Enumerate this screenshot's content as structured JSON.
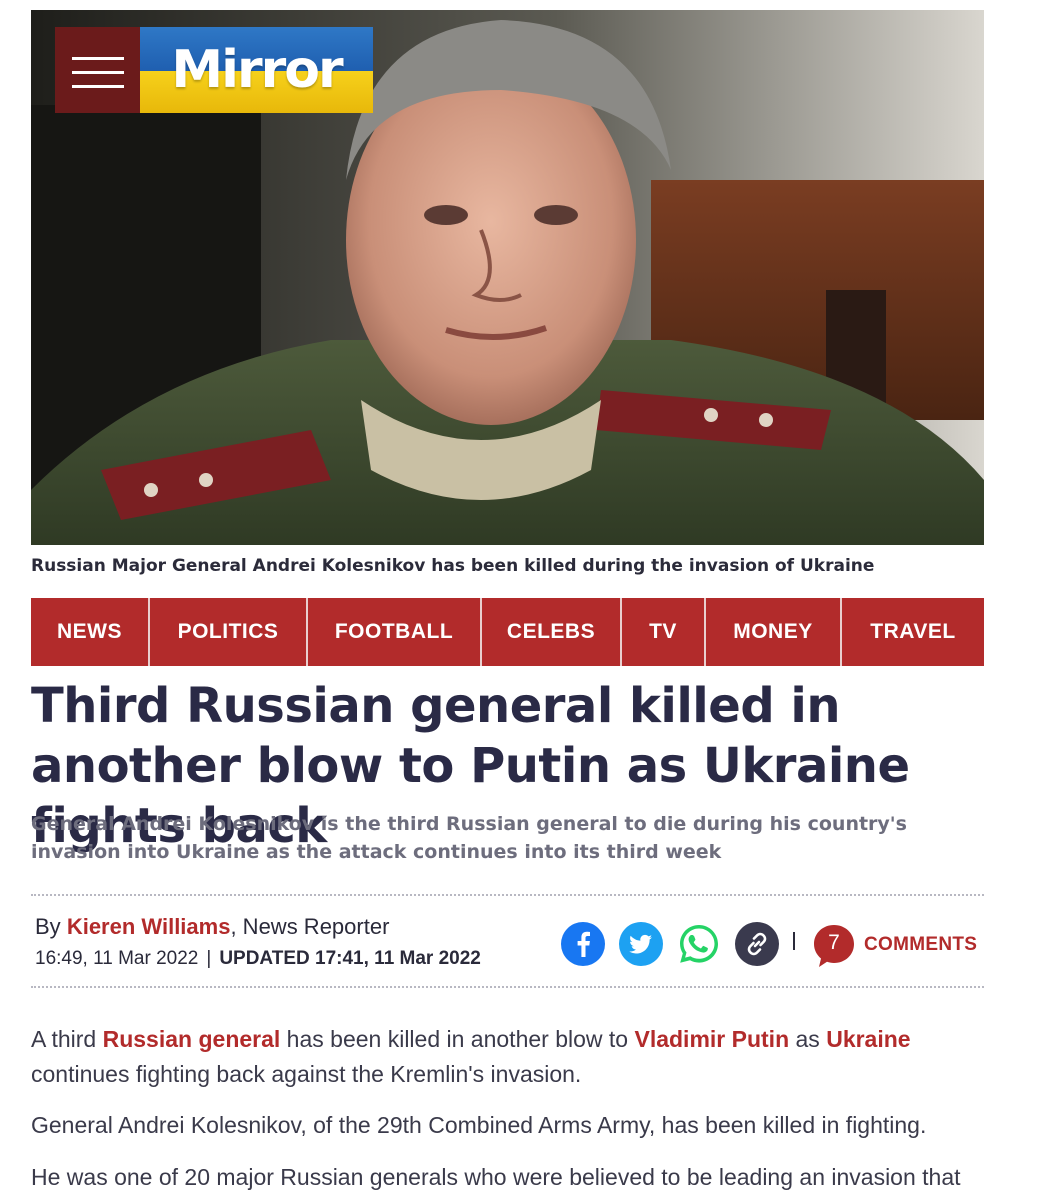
{
  "header": {
    "logo_text": "Mirror",
    "menu_icon": "hamburger-menu-icon"
  },
  "hero": {
    "caption": "Russian Major General Andrei Kolesnikov has been killed during the invasion of Ukraine"
  },
  "nav": {
    "items": [
      {
        "label": "NEWS"
      },
      {
        "label": "POLITICS"
      },
      {
        "label": "FOOTBALL"
      },
      {
        "label": "CELEBS"
      },
      {
        "label": "TV"
      },
      {
        "label": "MONEY"
      },
      {
        "label": "TRAVEL"
      }
    ]
  },
  "article": {
    "headline": "Third Russian general killed in another blow to Putin as Ukraine fights back",
    "standfirst": "General Andrei Kolesnikov is the third Russian general to die during his country's invasion into Ukraine as the attack continues into its third week",
    "byline": {
      "prefix": "By",
      "author": "Kieren Williams",
      "role": ", News Reporter",
      "published": "16:49, 11 Mar 2022",
      "separator": "|",
      "updated": "UPDATED 17:41, 11 Mar 2022"
    },
    "share": {
      "icons": [
        "facebook-icon",
        "twitter-icon",
        "whatsapp-icon",
        "link-icon"
      ],
      "divider": "|"
    },
    "comments": {
      "count": "7",
      "label": "COMMENTS"
    },
    "body": {
      "p1": {
        "t1": "A third ",
        "link1": "Russian general",
        "t2": " has been killed in another blow to ",
        "link2": "Vladimir Putin",
        "t3": " as ",
        "link3": "Ukraine",
        "t4": " continues fighting back against the Kremlin's invasion."
      },
      "p2": "General Andrei Kolesnikov, of the 29th Combined Arms Army, has been killed in fighting.",
      "p3": "He was one of 20 major Russian generals who were believed to be leading an invasion that"
    }
  },
  "colors": {
    "brand_red": "#b22b2b",
    "menu_bg": "#6b1b1b",
    "headline": "#2a2a46",
    "facebook": "#1877f2",
    "twitter": "#1da1f2",
    "whatsapp": "#25d366",
    "link_icon_bg": "#3a3a4e"
  }
}
